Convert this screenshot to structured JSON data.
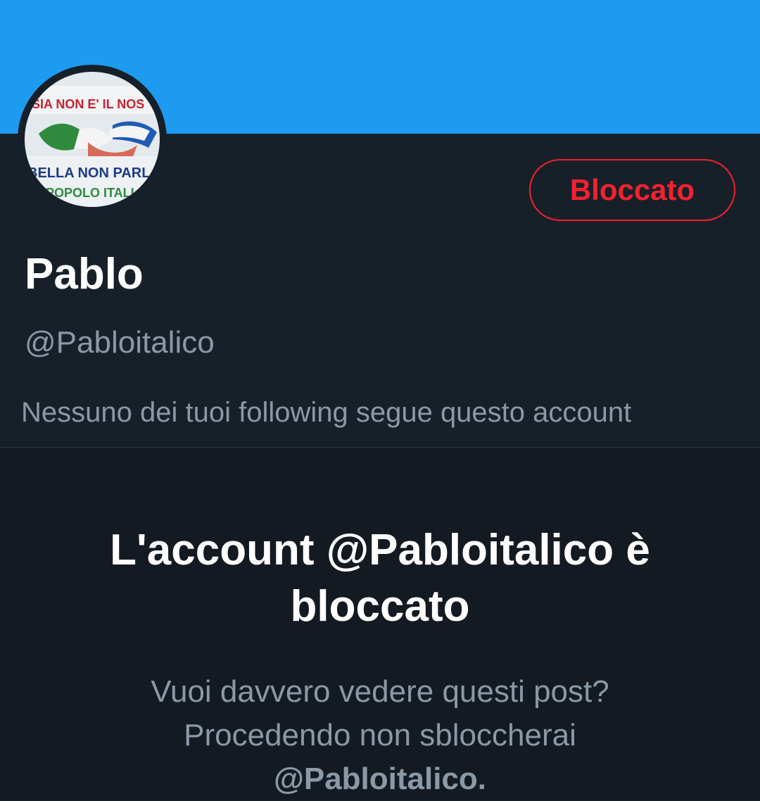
{
  "colors": {
    "banner": "#1d9bf0",
    "background": "#15202b",
    "blocked_accent": "#f4212e",
    "secondary_text": "#8b98a5"
  },
  "profile": {
    "display_name": "Pablo",
    "handle": "@Pabloitalico",
    "blocked_button_label": "Bloccato",
    "following_note": "Nessuno dei tuoi following segue questo account",
    "avatar": {
      "icon": "profile-photo-banner-image",
      "line1": "SIA NON E' IL NOS",
      "line2": "BELLA NON PARLA",
      "line3": "POPOLO ITALI"
    }
  },
  "blocked_notice": {
    "title_line1": "L'account @Pabloitalico è",
    "title_line2": "bloccato",
    "desc_line1": "Vuoi davvero vedere questi post?",
    "desc_line2": "Procedendo non sbloccherai",
    "desc_line3": "@Pabloitalico."
  }
}
